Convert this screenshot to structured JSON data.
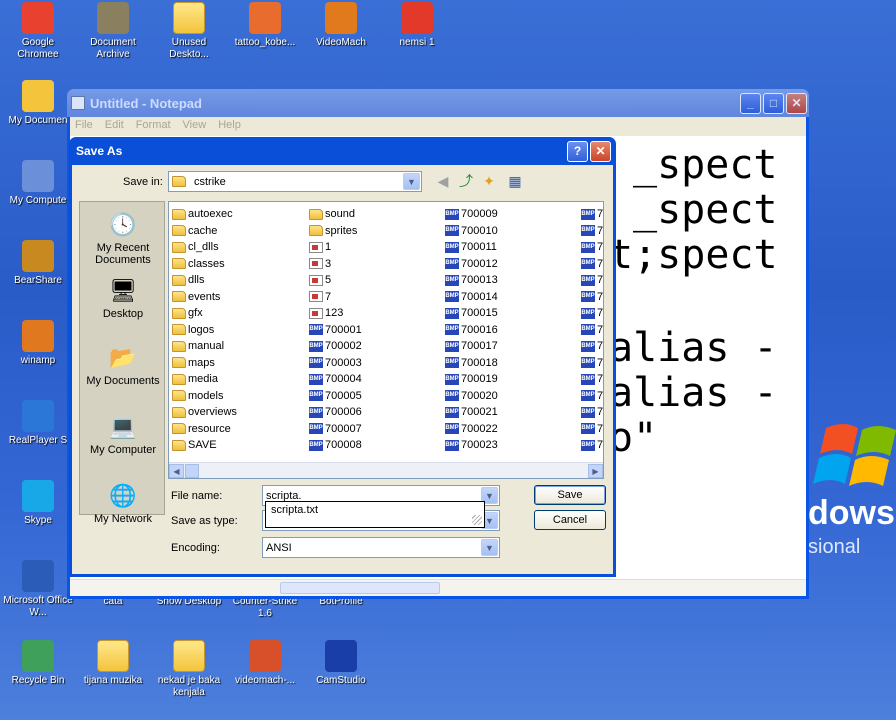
{
  "desktop": {
    "icons_top": [
      {
        "label": "Google Chromee",
        "glyph": "chrome-icon",
        "color": "#e8412f"
      },
      {
        "label": "Document Archive",
        "glyph": "archive-icon",
        "color": "#8a7f5f"
      },
      {
        "label": "Unused Deskto...",
        "glyph": "folder-icon",
        "color": "#f3c43c"
      },
      {
        "label": "tattoo_kobe...",
        "glyph": "image-icon",
        "color": "#e96c2f"
      },
      {
        "label": "VideoMach",
        "glyph": "videomach-icon",
        "color": "#e07a1c"
      },
      {
        "label": "nemsi 1",
        "glyph": "media-icon",
        "color": "#e2392a"
      }
    ],
    "icons_left": [
      {
        "label": "My Documen",
        "glyph": "my-documents-icon"
      },
      {
        "label": "My Compute",
        "glyph": "my-computer-icon"
      },
      {
        "label": "BearShare",
        "glyph": "bearshare-icon"
      },
      {
        "label": "winamp",
        "glyph": "winamp-icon"
      },
      {
        "label": "RealPlayer S",
        "glyph": "realplayer-icon"
      },
      {
        "label": "Skype",
        "glyph": "skype-icon"
      },
      {
        "label": "Microsoft Office W...",
        "glyph": "word-icon"
      },
      {
        "label": "Recycle Bin",
        "glyph": "recycle-bin-icon"
      }
    ],
    "icons_bottom_row1": [
      "cata",
      "Show Desktop",
      "Counter-Strike 1.6",
      "BotProfile"
    ],
    "icons_bottom_row2": [
      {
        "label": "tijana muzika",
        "glyph": "folder-icon"
      },
      {
        "label": "nekad je baka kenjala",
        "glyph": "folder-icon"
      },
      {
        "label": "videomach-...",
        "glyph": "gift-icon"
      },
      {
        "label": "CamStudio",
        "glyph": "camstudio-icon"
      }
    ],
    "wallpaper_text": "dows",
    "wallpaper_sub": "sional"
  },
  "notepad": {
    "title": "Untitled - Notepad",
    "menu": [
      "File",
      "Edit",
      "Format",
      "View",
      "Help"
    ],
    "lines": [
      "_spect",
      "_spect",
      "t;spect",
      "alias -",
      "alias -",
      "o\""
    ]
  },
  "dialog": {
    "title": "Save As",
    "save_in_label": "Save in:",
    "save_in_value": "cstrike",
    "places": [
      "My Recent Documents",
      "Desktop",
      "My Documents",
      "My Computer",
      "My Network"
    ],
    "columns": [
      [
        {
          "name": "autoexec",
          "type": "folder"
        },
        {
          "name": "cache",
          "type": "folder"
        },
        {
          "name": "cl_dlls",
          "type": "folder"
        },
        {
          "name": "classes",
          "type": "folder"
        },
        {
          "name": "dlls",
          "type": "folder"
        },
        {
          "name": "events",
          "type": "folder"
        },
        {
          "name": "gfx",
          "type": "folder"
        },
        {
          "name": "logos",
          "type": "folder"
        },
        {
          "name": "manual",
          "type": "folder"
        },
        {
          "name": "maps",
          "type": "folder"
        },
        {
          "name": "media",
          "type": "folder"
        },
        {
          "name": "models",
          "type": "folder"
        },
        {
          "name": "overviews",
          "type": "folder"
        },
        {
          "name": "resource",
          "type": "folder"
        },
        {
          "name": "SAVE",
          "type": "folder"
        }
      ],
      [
        {
          "name": "sound",
          "type": "folder"
        },
        {
          "name": "sprites",
          "type": "folder"
        },
        {
          "name": "1",
          "type": "doc"
        },
        {
          "name": "3",
          "type": "doc"
        },
        {
          "name": "5",
          "type": "doc"
        },
        {
          "name": "7",
          "type": "doc"
        },
        {
          "name": "123",
          "type": "doc"
        },
        {
          "name": "700001",
          "type": "bmp"
        },
        {
          "name": "700002",
          "type": "bmp"
        },
        {
          "name": "700003",
          "type": "bmp"
        },
        {
          "name": "700004",
          "type": "bmp"
        },
        {
          "name": "700005",
          "type": "bmp"
        },
        {
          "name": "700006",
          "type": "bmp"
        },
        {
          "name": "700007",
          "type": "bmp"
        },
        {
          "name": "700008",
          "type": "bmp"
        }
      ],
      [
        {
          "name": "700009",
          "type": "bmp"
        },
        {
          "name": "700010",
          "type": "bmp"
        },
        {
          "name": "700011",
          "type": "bmp"
        },
        {
          "name": "700012",
          "type": "bmp"
        },
        {
          "name": "700013",
          "type": "bmp"
        },
        {
          "name": "700014",
          "type": "bmp"
        },
        {
          "name": "700015",
          "type": "bmp"
        },
        {
          "name": "700016",
          "type": "bmp"
        },
        {
          "name": "700017",
          "type": "bmp"
        },
        {
          "name": "700018",
          "type": "bmp"
        },
        {
          "name": "700019",
          "type": "bmp"
        },
        {
          "name": "700020",
          "type": "bmp"
        },
        {
          "name": "700021",
          "type": "bmp"
        },
        {
          "name": "700022",
          "type": "bmp"
        },
        {
          "name": "700023",
          "type": "bmp"
        }
      ],
      [
        {
          "name": "7",
          "type": "bmp"
        },
        {
          "name": "7",
          "type": "bmp"
        },
        {
          "name": "7",
          "type": "bmp"
        },
        {
          "name": "7",
          "type": "bmp"
        },
        {
          "name": "7",
          "type": "bmp"
        },
        {
          "name": "7",
          "type": "bmp"
        },
        {
          "name": "7",
          "type": "bmp"
        },
        {
          "name": "7",
          "type": "bmp"
        },
        {
          "name": "7",
          "type": "bmp"
        },
        {
          "name": "7",
          "type": "bmp"
        },
        {
          "name": "7",
          "type": "bmp"
        },
        {
          "name": "7",
          "type": "bmp"
        },
        {
          "name": "7",
          "type": "bmp"
        },
        {
          "name": "7",
          "type": "bmp"
        },
        {
          "name": "7",
          "type": "bmp"
        }
      ]
    ],
    "file_name_label": "File name:",
    "file_name_value": "scripta.",
    "autocomplete_suggestion": "scripta.txt",
    "save_as_type_label": "Save as type:",
    "encoding_label": "Encoding:",
    "encoding_value": "ANSI",
    "save_label": "Save",
    "cancel_label": "Cancel"
  }
}
